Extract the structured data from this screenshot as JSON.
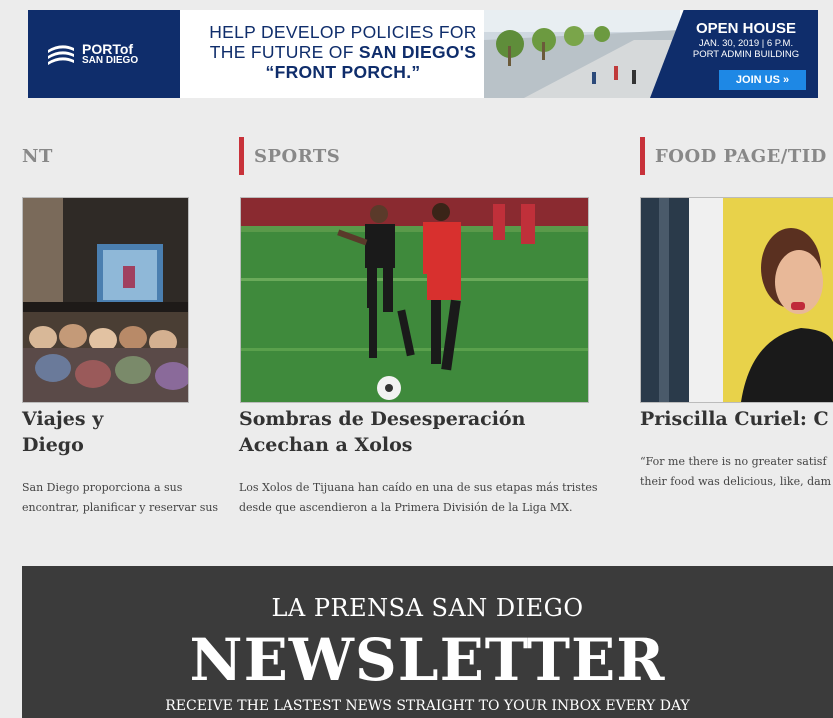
{
  "ad": {
    "logo_line1": "PORTof",
    "logo_line2": "SAN DIEGO",
    "headline_line1": "HELP DEVELOP POLICIES FOR",
    "headline_line2a": "THE FUTURE OF ",
    "headline_line2b": "SAN DIEGO'S",
    "headline_line3": "“FRONT PORCH.”",
    "open_house": "OPEN HOUSE",
    "date_line": "JAN. 30, 2019  |  6 P.M.",
    "place_line": "PORT ADMIN BUILDING",
    "join_label": "JOIN US »",
    "colors": {
      "navy": "#0f2d6b",
      "button": "#1e88e5"
    }
  },
  "sections": [
    {
      "label": "NT"
    },
    {
      "label": "SPORTS"
    },
    {
      "label": "FOOD PAGE/TID"
    }
  ],
  "articles": [
    {
      "title_line1": "Viajes y",
      "title_line2": "Diego",
      "excerpt_line1": "San Diego proporciona a sus",
      "excerpt_line2": "encontrar, planificar y reservar sus"
    },
    {
      "title_line1": "Sombras de Desesperación",
      "title_line2": "Acechan a Xolos",
      "excerpt_line1": "Los Xolos de Tijuana han caído en una de sus etapas más tristes",
      "excerpt_line2": "desde que ascendieron a la Primera División de la Liga MX."
    },
    {
      "title_line1": "Priscilla Curiel: C",
      "title_line2": "",
      "excerpt_line1": "“For me there is no greater satisf",
      "excerpt_line2": "their food was delicious, like, dam"
    }
  ],
  "newsletter": {
    "line1": "LA PRENSA SAN DIEGO",
    "line2": "NEWSLETTER",
    "line3": "RECEIVE THE LASTEST NEWS STRAIGHT TO YOUR INBOX EVERY DAY"
  },
  "accent_color": "#c8323a"
}
